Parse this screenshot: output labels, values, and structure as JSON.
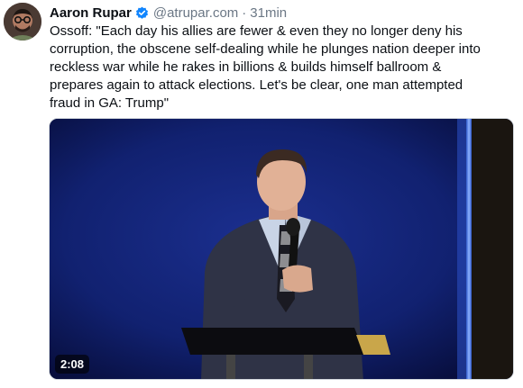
{
  "post": {
    "author": {
      "display_name": "Aaron Rupar",
      "handle": "@atrupar.com",
      "verified_icon": "verified-check-icon",
      "accent_color": "#1185fe"
    },
    "separator": "·",
    "timestamp": "31min",
    "text": "Ossoff: \"Each day his allies are fewer & even they no longer deny his\ncorruption, the obscene self-dealing while he plunges nation deeper into\nreckless war while he rakes in billions & builds himself ballroom &\nprepares again to attack elections. Let's be clear, one man attempted\nfraud in GA: Trump\"",
    "media": {
      "type": "video",
      "duration": "2:08"
    }
  }
}
